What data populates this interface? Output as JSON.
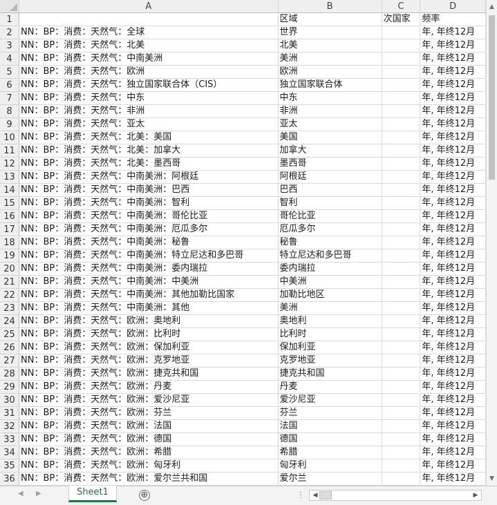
{
  "columns": [
    "A",
    "B",
    "C",
    "D"
  ],
  "rows": [
    {
      "num": "1",
      "a": "",
      "b": "区域",
      "c": "次国家",
      "d": "频率"
    },
    {
      "num": "2",
      "a": "NN：BP：消费：天然气：全球",
      "b": "世界",
      "c": "",
      "d": "年, 年终12月"
    },
    {
      "num": "3",
      "a": "NN：BP：消费：天然气：北美",
      "b": "北美",
      "c": "",
      "d": "年, 年终12月"
    },
    {
      "num": "4",
      "a": "NN：BP：消费：天然气：中南美洲",
      "b": "美洲",
      "c": "",
      "d": "年, 年终12月"
    },
    {
      "num": "5",
      "a": "NN：BP：消费：天然气：欧洲",
      "b": "欧洲",
      "c": "",
      "d": "年, 年终12月"
    },
    {
      "num": "6",
      "a": "NN：BP：消费：天然气：独立国家联合体（CIS）",
      "b": "独立国家联合体",
      "c": "",
      "d": "年, 年终12月"
    },
    {
      "num": "7",
      "a": "NN：BP：消费：天然气：中东",
      "b": "中东",
      "c": "",
      "d": "年, 年终12月"
    },
    {
      "num": "8",
      "a": "NN：BP：消费：天然气：非洲",
      "b": "非洲",
      "c": "",
      "d": "年, 年终12月"
    },
    {
      "num": "9",
      "a": "NN：BP：消费：天然气：亚太",
      "b": "亚太",
      "c": "",
      "d": "年, 年终12月"
    },
    {
      "num": "10",
      "a": "NN：BP：消费：天然气：北美：美国",
      "b": "美国",
      "c": "",
      "d": "年, 年终12月"
    },
    {
      "num": "11",
      "a": "NN：BP：消费：天然气：北美：加拿大",
      "b": "加拿大",
      "c": "",
      "d": "年, 年终12月"
    },
    {
      "num": "12",
      "a": "NN：BP：消费：天然气：北美：墨西哥",
      "b": "墨西哥",
      "c": "",
      "d": "年, 年终12月"
    },
    {
      "num": "13",
      "a": "NN：BP：消费：天然气：中南美洲：阿根廷",
      "b": "阿根廷",
      "c": "",
      "d": "年, 年终12月"
    },
    {
      "num": "14",
      "a": "NN：BP：消费：天然气：中南美洲：巴西",
      "b": "巴西",
      "c": "",
      "d": "年, 年终12月"
    },
    {
      "num": "15",
      "a": "NN：BP：消费：天然气：中南美洲：智利",
      "b": "智利",
      "c": "",
      "d": "年, 年终12月"
    },
    {
      "num": "16",
      "a": "NN：BP：消费：天然气：中南美洲：哥伦比亚",
      "b": "哥伦比亚",
      "c": "",
      "d": "年, 年终12月"
    },
    {
      "num": "17",
      "a": "NN：BP：消费：天然气：中南美洲：厄瓜多尔",
      "b": "厄瓜多尔",
      "c": "",
      "d": "年, 年终12月"
    },
    {
      "num": "18",
      "a": "NN：BP：消费：天然气：中南美洲：秘鲁",
      "b": "秘鲁",
      "c": "",
      "d": "年, 年终12月"
    },
    {
      "num": "19",
      "a": "NN：BP：消费：天然气：中南美洲：特立尼达和多巴哥",
      "b": "特立尼达和多巴哥",
      "c": "",
      "d": "年, 年终12月"
    },
    {
      "num": "20",
      "a": "NN：BP：消费：天然气：中南美洲：委内瑞拉",
      "b": "委内瑞拉",
      "c": "",
      "d": "年, 年终12月"
    },
    {
      "num": "21",
      "a": "NN：BP：消费：天然气：中南美洲：中美洲",
      "b": "中美洲",
      "c": "",
      "d": "年, 年终12月"
    },
    {
      "num": "22",
      "a": "NN：BP：消费：天然气：中南美洲：其他加勒比国家",
      "b": "加勒比地区",
      "c": "",
      "d": "年, 年终12月"
    },
    {
      "num": "23",
      "a": "NN：BP：消费：天然气：中南美洲：其他",
      "b": "美洲",
      "c": "",
      "d": "年, 年终12月"
    },
    {
      "num": "24",
      "a": "NN：BP：消费：天然气：欧洲：奥地利",
      "b": "奥地利",
      "c": "",
      "d": "年, 年终12月"
    },
    {
      "num": "25",
      "a": "NN：BP：消费：天然气：欧洲：比利时",
      "b": "比利时",
      "c": "",
      "d": "年, 年终12月"
    },
    {
      "num": "26",
      "a": "NN：BP：消费：天然气：欧洲：保加利亚",
      "b": "保加利亚",
      "c": "",
      "d": "年, 年终12月"
    },
    {
      "num": "27",
      "a": "NN：BP：消费：天然气：欧洲：克罗地亚",
      "b": "克罗地亚",
      "c": "",
      "d": "年, 年终12月"
    },
    {
      "num": "28",
      "a": "NN：BP：消费：天然气：欧洲：捷克共和国",
      "b": "捷克共和国",
      "c": "",
      "d": "年, 年终12月"
    },
    {
      "num": "29",
      "a": "NN：BP：消费：天然气：欧洲：丹麦",
      "b": "丹麦",
      "c": "",
      "d": "年, 年终12月"
    },
    {
      "num": "30",
      "a": "NN：BP：消费：天然气：欧洲：爱沙尼亚",
      "b": "爱沙尼亚",
      "c": "",
      "d": "年, 年终12月"
    },
    {
      "num": "31",
      "a": "NN：BP：消费：天然气：欧洲：芬兰",
      "b": "芬兰",
      "c": "",
      "d": "年, 年终12月"
    },
    {
      "num": "32",
      "a": "NN：BP：消费：天然气：欧洲：法国",
      "b": "法国",
      "c": "",
      "d": "年, 年终12月"
    },
    {
      "num": "33",
      "a": "NN：BP：消费：天然气：欧洲：德国",
      "b": "德国",
      "c": "",
      "d": "年, 年终12月"
    },
    {
      "num": "34",
      "a": "NN：BP：消费：天然气：欧洲：希腊",
      "b": "希腊",
      "c": "",
      "d": "年, 年终12月"
    },
    {
      "num": "35",
      "a": "NN：BP：消费：天然气：欧洲：匈牙利",
      "b": "匈牙利",
      "c": "",
      "d": "年, 年终12月"
    },
    {
      "num": "36",
      "a": "NN：BP：消费：天然气：欧洲：爱尔兰共和国",
      "b": "爱尔兰",
      "c": "",
      "d": "年, 年终12月"
    }
  ],
  "sheet_tab": "Sheet1",
  "add_sheet": "⊕",
  "more_indicator": "⋮",
  "colors": {
    "accent": "#217346",
    "header_bg": "#efefef",
    "gridline": "#d9d9d9"
  }
}
